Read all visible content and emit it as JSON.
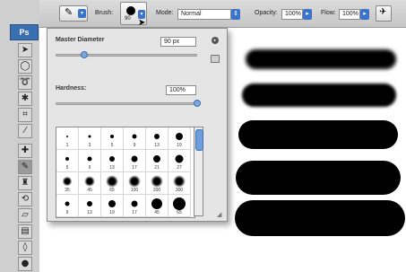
{
  "options_bar": {
    "brush_label": "Brush:",
    "brush_size": "90",
    "mode_label": "Mode:",
    "mode_value": "Normal",
    "opacity_label": "Opacity:",
    "opacity_value": "100%",
    "flow_label": "Flow:",
    "flow_value": "100%"
  },
  "toolbox": {
    "logo": "Ps"
  },
  "brush_panel": {
    "master_diameter_label": "Master Diameter",
    "master_diameter_value": "90 px",
    "master_diameter_fraction": 0.2,
    "hardness_label": "Hardness:",
    "hardness_value": "100%",
    "hardness_fraction": 1.0,
    "presets": [
      [
        {
          "size": 1,
          "label": "1"
        },
        {
          "size": 3,
          "label": "3"
        },
        {
          "size": 5,
          "label": "5"
        },
        {
          "size": 9,
          "label": "9"
        },
        {
          "size": 13,
          "label": "13"
        },
        {
          "size": 19,
          "label": "19"
        }
      ],
      [
        {
          "size": 5,
          "label": "5"
        },
        {
          "size": 9,
          "label": "9"
        },
        {
          "size": 13,
          "label": "13"
        },
        {
          "size": 17,
          "label": "17"
        },
        {
          "size": 21,
          "label": "21"
        },
        {
          "size": 27,
          "label": "27"
        }
      ],
      [
        {
          "size": 35,
          "label": "35"
        },
        {
          "size": 45,
          "label": "45"
        },
        {
          "size": 65,
          "label": "65"
        },
        {
          "size": 100,
          "label": "100"
        },
        {
          "size": 200,
          "label": "200"
        },
        {
          "size": 300,
          "label": "300"
        }
      ],
      [
        {
          "size": 9,
          "label": "9"
        },
        {
          "size": 13,
          "label": "13"
        },
        {
          "size": 19,
          "label": "19"
        },
        {
          "size": 17,
          "label": "17"
        },
        {
          "size": 45,
          "label": "45"
        },
        {
          "size": 65,
          "label": "65"
        }
      ]
    ]
  },
  "canvas": {
    "strokes": [
      "soft",
      "soft",
      "hard",
      "hard",
      "hard"
    ]
  }
}
